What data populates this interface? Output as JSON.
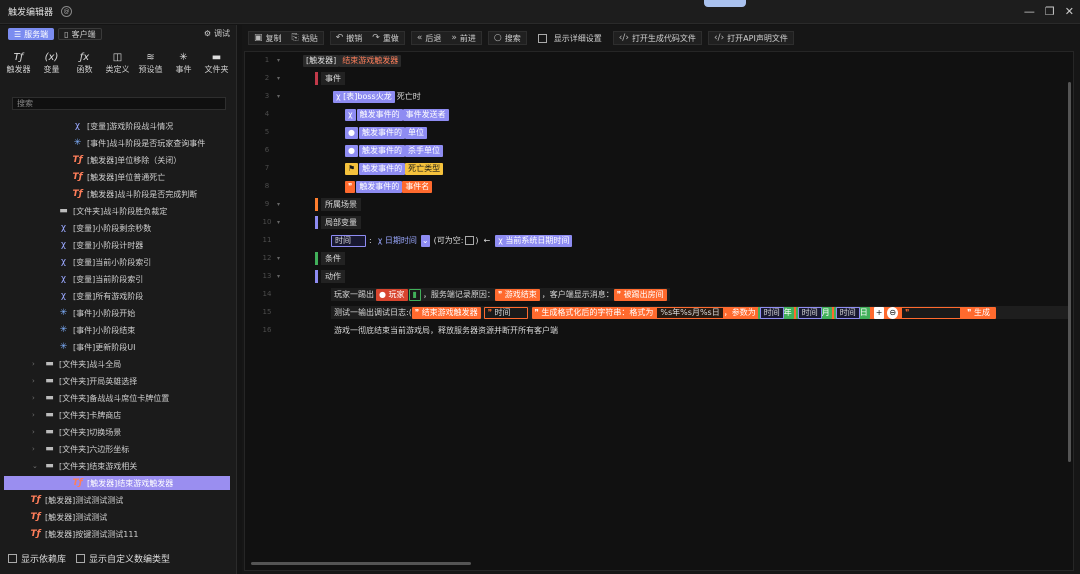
{
  "window": {
    "title": "触发编辑器",
    "minimize": "—",
    "restore": "❐",
    "close": "✕"
  },
  "left": {
    "tabs": [
      {
        "label": "服务端",
        "active": true
      },
      {
        "label": "客户端",
        "active": false
      }
    ],
    "debug_label": "调试",
    "tools": [
      "触发器",
      "变量",
      "函数",
      "类定义",
      "预设值",
      "事件",
      "文件夹"
    ],
    "search_placeholder": "搜索",
    "tree": [
      {
        "icon": "var",
        "label": "[变量]游戏阶段战斗情况",
        "indent": 72
      },
      {
        "icon": "evt",
        "label": "[事件]战斗阶段是否玩家查询事件",
        "indent": 72
      },
      {
        "icon": "trg",
        "label": "[触发器]单位移除（关闭）",
        "indent": 72
      },
      {
        "icon": "trg",
        "label": "[触发器]单位普通死亡",
        "indent": 72
      },
      {
        "icon": "trg",
        "label": "[触发器]战斗阶段是否完成判断",
        "indent": 72
      },
      {
        "icon": "fld",
        "label": "[文件夹]战斗阶段胜负裁定",
        "indent": 58
      },
      {
        "icon": "var",
        "label": "[变量]小阶段剩余秒数",
        "indent": 58
      },
      {
        "icon": "var",
        "label": "[变量]小阶段计时器",
        "indent": 58
      },
      {
        "icon": "var",
        "label": "[变量]当前小阶段索引",
        "indent": 58
      },
      {
        "icon": "var",
        "label": "[变量]当前阶段索引",
        "indent": 58
      },
      {
        "icon": "var",
        "label": "[变量]所有游戏阶段",
        "indent": 58
      },
      {
        "icon": "evt",
        "label": "[事件]小阶段开始",
        "indent": 58
      },
      {
        "icon": "evt",
        "label": "[事件]小阶段结束",
        "indent": 58
      },
      {
        "icon": "evt",
        "label": "[事件]更新阶段UI",
        "indent": 58
      },
      {
        "icon": "fld",
        "label": "[文件夹]战斗全局",
        "indent": 44,
        "arrow": "›"
      },
      {
        "icon": "fld",
        "label": "[文件夹]开局英雄选择",
        "indent": 44,
        "arrow": "›"
      },
      {
        "icon": "fld",
        "label": "[文件夹]备战战斗席位卡牌位置",
        "indent": 44,
        "arrow": "›"
      },
      {
        "icon": "fld",
        "label": "[文件夹]卡牌商店",
        "indent": 44,
        "arrow": "›"
      },
      {
        "icon": "fld",
        "label": "[文件夹]切换场景",
        "indent": 44,
        "arrow": "›"
      },
      {
        "icon": "fld",
        "label": "[文件夹]六边形坐标",
        "indent": 44,
        "arrow": "›"
      },
      {
        "icon": "fld",
        "label": "[文件夹]结束游戏相关",
        "indent": 44,
        "arrow": "⌄"
      },
      {
        "icon": "trg",
        "label": "[触发器]结束游戏触发器",
        "indent": 58,
        "selected": true
      },
      {
        "icon": "trg",
        "label": "[触发器]测试测试测试",
        "indent": 30
      },
      {
        "icon": "trg",
        "label": "[触发器]测试测试",
        "indent": 30
      },
      {
        "icon": "trg",
        "label": "[触发器]按键测试测试111",
        "indent": 30
      }
    ],
    "options": [
      "显示依赖库",
      "显示自定义数编类型"
    ]
  },
  "toolbar": {
    "copy": "复制",
    "paste": "粘贴",
    "undo": "撤销",
    "redo": "重做",
    "back": "后退",
    "forward": "前进",
    "search": "搜索",
    "show_detail": "显示详细设置",
    "open_gen": "打开生成代码文件",
    "open_api": "打开API声明文件"
  },
  "editor": {
    "line_numbers": [
      "1",
      "2",
      "3",
      "4",
      "5",
      "6",
      "7",
      "8",
      "9",
      "10",
      "11",
      "12",
      "13",
      "14",
      "15",
      "16"
    ],
    "trigger_tag": "[触发器]",
    "trigger_name": "结束游戏触发器",
    "event_header": "事件",
    "event_source": "[表]boss火龙",
    "event_name": "死亡时",
    "event_params": [
      {
        "prefix": "触发事件的",
        "name": "事件发送者",
        "color": "pu"
      },
      {
        "prefix": "触发事件的",
        "name": "单位",
        "color": "pu"
      },
      {
        "prefix": "触发事件的",
        "name": "杀手单位",
        "color": "pu"
      },
      {
        "prefix": "触发事件的",
        "name": "死亡类型",
        "color": "ye"
      },
      {
        "prefix": "触发事件的",
        "name": "事件名",
        "color": "or"
      }
    ],
    "scene_header": "所属场景",
    "local_header": "局部变量",
    "local_var_name": "时间",
    "local_var_type": "日期时间",
    "nullable_label": "(可为空:",
    "nullable_close": ")",
    "assign_arrow": "←",
    "local_var_value": "当前系统日期时间",
    "cond_header": "条件",
    "action_header": "动作",
    "action1_a": "玩家一踢出",
    "action1_player": "玩家",
    "action1_b": "，服务端记录原因：",
    "action1_reason": "游戏结束",
    "action1_c": "，客户端显示消息：",
    "action1_msg": "被踢出房间",
    "action2_a": "测试一输出调试日志:(",
    "action2_s1": "结束游戏触发器",
    "action2_s2": "时间",
    "action2_fmt_label": "生成格式化后的字符串：格式为",
    "action2_fmt": "%s年%s月%s日",
    "action2_params": "，参数为",
    "action2_p1": "时间",
    "action2_p1s": "年",
    "action2_p2": "时间",
    "action2_p2s": "月",
    "action2_p3": "时间",
    "action2_p3s": "日",
    "action2_tail": "生成",
    "action3": "游戏一彻底结束当前游戏局，释放服务器资源并断开所有客户端"
  }
}
